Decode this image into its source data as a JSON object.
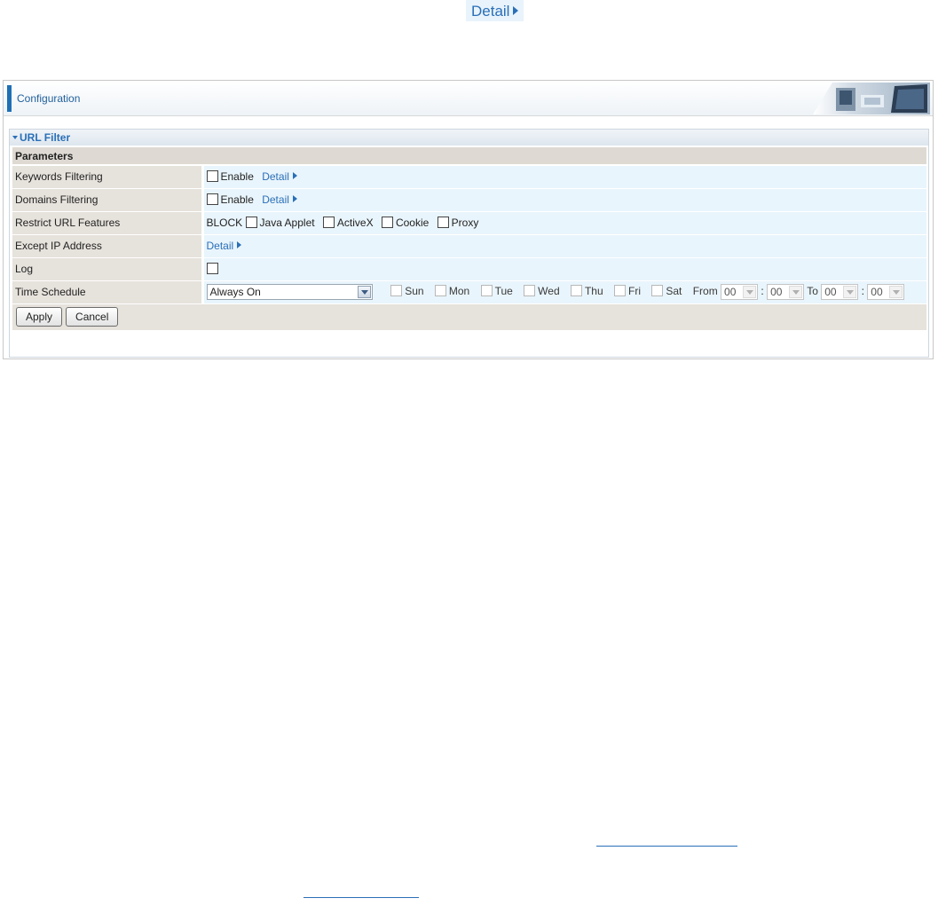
{
  "top_link": {
    "label": "Detail"
  },
  "config": {
    "title": "Configuration"
  },
  "section": {
    "title": "URL Filter"
  },
  "params": {
    "group_title": "Parameters",
    "keywords": {
      "label": "Keywords Filtering",
      "enable_label": "Enable",
      "detail_label": "Detail"
    },
    "domains": {
      "label": "Domains Filtering",
      "enable_label": "Enable",
      "detail_label": "Detail"
    },
    "restrict": {
      "label": "Restrict URL Features",
      "block_label": "BLOCK",
      "options": [
        "Java Applet",
        "ActiveX",
        "Cookie",
        "Proxy"
      ]
    },
    "except_ip": {
      "label": "Except IP Address",
      "detail_label": "Detail"
    },
    "log": {
      "label": "Log"
    },
    "schedule": {
      "label": "Time Schedule",
      "selected": "Always On",
      "days": [
        "Sun",
        "Mon",
        "Tue",
        "Wed",
        "Thu",
        "Fri",
        "Sat"
      ],
      "from_label": "From",
      "to_label": "To",
      "separator": ":",
      "from_hour": "00",
      "from_min": "00",
      "to_hour": "00",
      "to_min": "00"
    }
  },
  "actions": {
    "apply": "Apply",
    "cancel": "Cancel"
  },
  "colors": {
    "accent": "#1f6fb5",
    "link": "#2a6fb8",
    "label_bg": "#e6e2dc",
    "value_bg": "#e9f5fc"
  }
}
